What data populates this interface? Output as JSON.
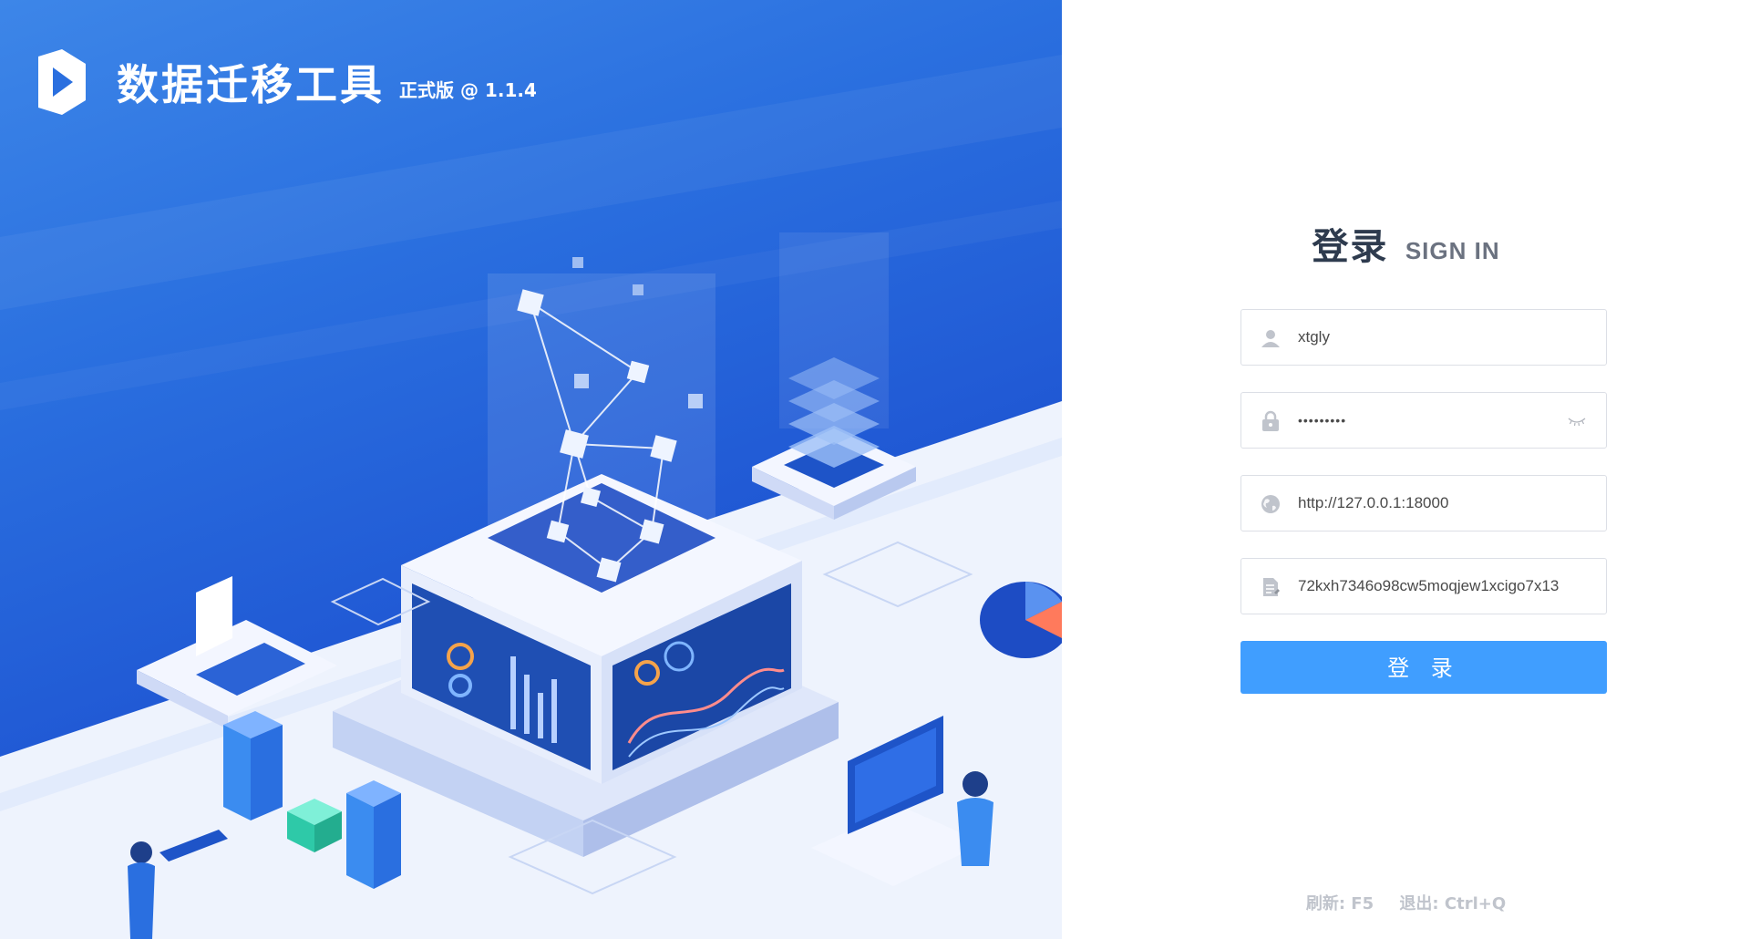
{
  "brand": {
    "title": "数据迁移工具",
    "version": "正式版 @ 1.1.4"
  },
  "login": {
    "heading_cn": "登录",
    "heading_en": "SIGN IN",
    "username": {
      "value": "xtgly",
      "icon": "user-icon"
    },
    "password": {
      "value": "•••••••••",
      "icon": "lock-icon",
      "toggle_icon": "eye-closed-icon"
    },
    "server": {
      "value": "http://127.0.0.1:18000",
      "icon": "globe-icon"
    },
    "token": {
      "value": "72kxh7346o98cw5moqjew1xcigo7x13",
      "icon": "document-icon"
    },
    "submit_label": "登 录"
  },
  "hints": {
    "refresh": "刷新: F5",
    "exit": "退出: Ctrl+Q"
  },
  "colors": {
    "hero_blue": "#2058d4",
    "button_blue": "#409eff",
    "heading": "#2e3b4e",
    "hint": "#c0c4cc"
  }
}
